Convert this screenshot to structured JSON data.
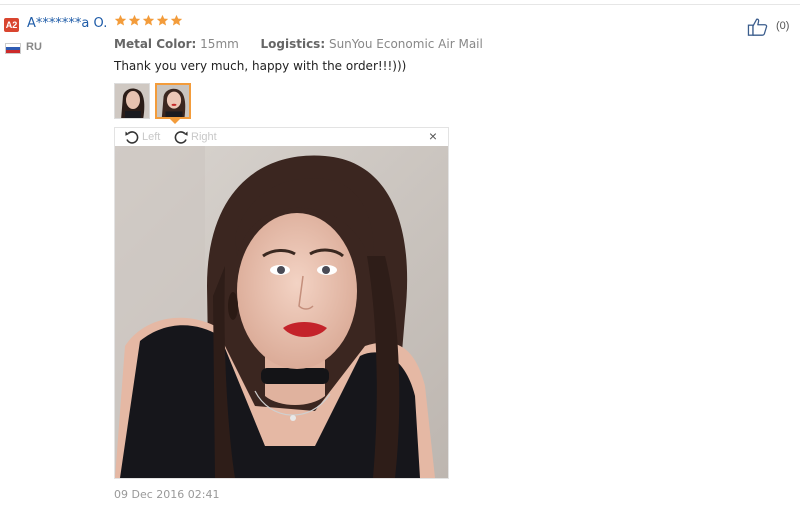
{
  "review": {
    "user_level": "A2",
    "user_name": "A*******a O.",
    "country": "RU",
    "rating": 5,
    "attributes": [
      {
        "key": "Metal Color:",
        "value": "15mm"
      },
      {
        "key": "Logistics:",
        "value": "SunYou Economic Air Mail"
      }
    ],
    "feedback": "Thank you very much, happy with the order!!!)))",
    "helpful_count": "(0)",
    "date": "09 Dec 2016 02:41"
  },
  "viewer": {
    "rotate_left_label": "Left",
    "rotate_right_label": "Right",
    "close_label": "×"
  },
  "icons": {
    "star": "star-icon",
    "thumb": "thumbs-up-icon",
    "rotate_left": "rotate-left-icon",
    "rotate_right": "rotate-right-icon",
    "close": "close-icon",
    "flag": "russia-flag-icon"
  },
  "colors": {
    "star": "#f39c3b",
    "user_name": "#1f5ca8",
    "level_badge": "#d9452f",
    "selected_thumb_border": "#f39c3b"
  }
}
